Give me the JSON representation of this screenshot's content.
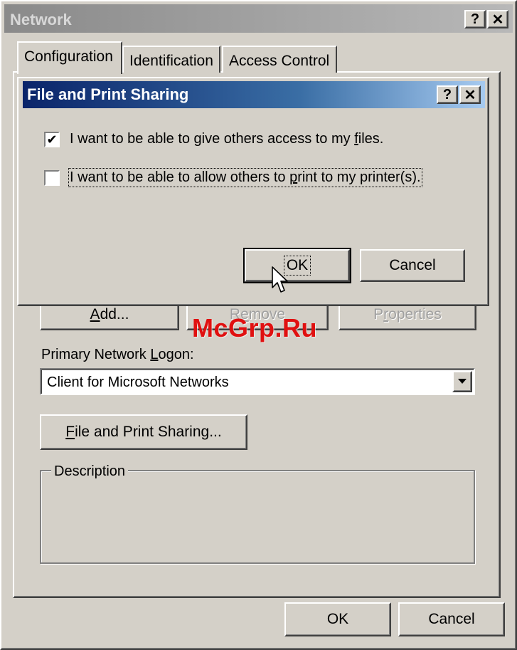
{
  "main_window": {
    "title": "Network",
    "help_button": "?",
    "close_button": "✕"
  },
  "tabs": [
    {
      "label": "Configuration",
      "active": true
    },
    {
      "label": "Identification",
      "active": false
    },
    {
      "label": "Access Control",
      "active": false
    }
  ],
  "panel": {
    "add_button": {
      "pre": "",
      "u": "A",
      "post": "dd..."
    },
    "remove_button": {
      "pre": "R",
      "u": "e",
      "post": "move"
    },
    "properties_button": {
      "pre": "P",
      "u": "r",
      "post": "operties"
    },
    "primary_logon_label": {
      "pre": "Primary Network ",
      "u": "L",
      "post": "ogon:"
    },
    "primary_logon_value": "Client for Microsoft Networks",
    "file_print_button": {
      "pre": "",
      "u": "F",
      "post": "ile and Print Sharing..."
    },
    "description_label": "Description"
  },
  "dialog": {
    "title": "File and Print Sharing",
    "help_button": "?",
    "close_button": "✕",
    "options": [
      {
        "pre": "I want to be able to give others access to my ",
        "u": "f",
        "post": "iles.",
        "checked": true
      },
      {
        "pre": "I want to be able to allow others to ",
        "u": "p",
        "post": "rint to my printer(s).",
        "checked": false
      }
    ],
    "ok_label": "OK",
    "cancel_label": "Cancel"
  },
  "footer": {
    "ok_label": "OK",
    "cancel_label": "Cancel"
  },
  "watermark": "McGrp.Ru"
}
